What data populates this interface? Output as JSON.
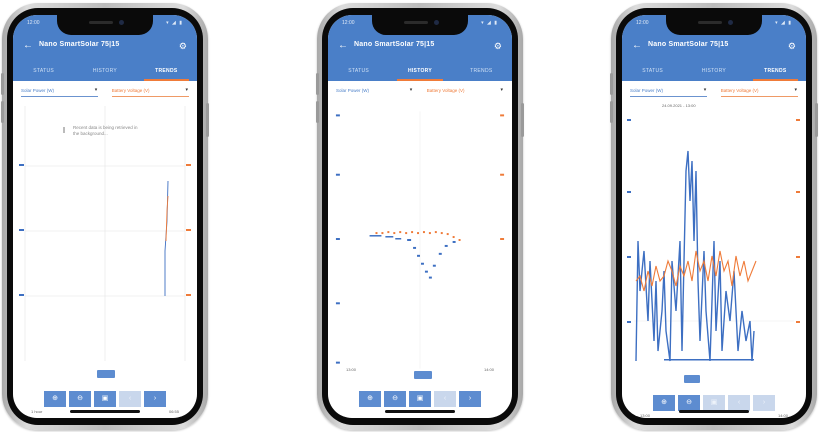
{
  "colors": {
    "app_bar": "#4a7fc8",
    "series_primary": "#3d6fc2",
    "series_secondary": "#ef7b39",
    "tab_indicator": "#ef7b39"
  },
  "phones": [
    {
      "status": {
        "time": "12:00",
        "icons": "▾ ◢ ▮"
      },
      "title": "Nano SmartSolar 75|15",
      "tabs": [
        {
          "label": "STATUS"
        },
        {
          "label": "HISTORY"
        },
        {
          "label": "TRENDS"
        }
      ],
      "active_tab": 2,
      "selectors": {
        "left": "Solar Power (W)",
        "right": "Battery Voltage (V)"
      },
      "message": "Recent data is being retrieved in the background...",
      "footer": {
        "left": "1 hour",
        "right": "06:55"
      },
      "toolbar": [
        {
          "icon": "zoom-in-icon",
          "glyph": "⊕"
        },
        {
          "icon": "zoom-out-icon",
          "glyph": "⊖"
        },
        {
          "icon": "fit-icon",
          "glyph": "▣"
        },
        {
          "icon": "prev-icon",
          "glyph": "‹"
        },
        {
          "icon": "next-icon",
          "glyph": "›"
        }
      ]
    },
    {
      "status": {
        "time": "12:00",
        "icons": "▾ ◢ ▮"
      },
      "title": "Nano SmartSolar 75|15",
      "tabs": [
        {
          "label": "STATUS"
        },
        {
          "label": "HISTORY"
        },
        {
          "label": "TRENDS"
        }
      ],
      "active_tab": 1,
      "selectors": {
        "left": "Solar Power (W)",
        "right": "Battery Voltage (V)"
      },
      "footer": {
        "left": "13:00",
        "right": "14:00"
      },
      "toolbar": [
        {
          "icon": "zoom-in-icon",
          "glyph": "⊕"
        },
        {
          "icon": "zoom-out-icon",
          "glyph": "⊖"
        },
        {
          "icon": "fit-icon",
          "glyph": "▣"
        },
        {
          "icon": "prev-icon",
          "glyph": "‹"
        },
        {
          "icon": "next-icon",
          "glyph": "›"
        }
      ]
    },
    {
      "status": {
        "time": "12:00",
        "icons": "▾ ◢ ▮"
      },
      "title": "Nano SmartSolar 75|15",
      "tabs": [
        {
          "label": "STATUS"
        },
        {
          "label": "HISTORY"
        },
        {
          "label": "TRENDS"
        }
      ],
      "active_tab": 2,
      "selectors": {
        "left": "Solar Power (W)",
        "right": "Battery Voltage (V)"
      },
      "subheader": "24.09.2021 - 13:00",
      "footer": {
        "left": "13:00",
        "right": "14:00"
      },
      "toolbar": [
        {
          "icon": "zoom-in-icon",
          "glyph": "⊕"
        },
        {
          "icon": "zoom-out-icon",
          "glyph": "⊖"
        },
        {
          "icon": "fit-icon",
          "glyph": "▣"
        },
        {
          "icon": "prev-icon",
          "glyph": "‹"
        },
        {
          "icon": "next-icon",
          "glyph": "›"
        }
      ]
    }
  ]
}
